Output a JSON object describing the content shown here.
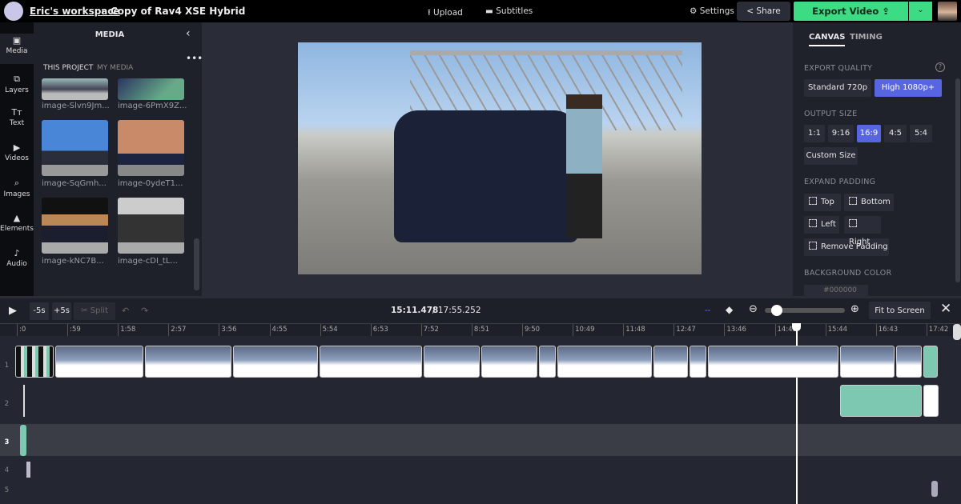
{
  "header": {
    "workspace": "Eric's workspace",
    "separator": "›",
    "project": "Copy of Rav4 XSE Hybrid",
    "upload": "Upload",
    "subtitles": "Subtitles",
    "settings": "Settings",
    "share": "Share",
    "export": "Export Video"
  },
  "rail": [
    {
      "label": "Media",
      "icon": "media-icon"
    },
    {
      "label": "Layers",
      "icon": "layers-icon"
    },
    {
      "label": "Text",
      "icon": "text-icon"
    },
    {
      "label": "Videos",
      "icon": "videos-icon"
    },
    {
      "label": "Images",
      "icon": "images-icon"
    },
    {
      "label": "Elements",
      "icon": "elements-icon"
    },
    {
      "label": "Audio",
      "icon": "audio-icon"
    }
  ],
  "media": {
    "title": "MEDIA",
    "tabs": [
      "THIS PROJECT",
      "MY MEDIA"
    ],
    "items": [
      "image-Slvn9Jm...",
      "image-6PmX9Z...",
      "image-SqGmh...",
      "image-0ydeT1...",
      "image-kNC7B...",
      "image-cDI_tL..."
    ]
  },
  "right": {
    "tabs": [
      "CANVAS",
      "TIMING"
    ],
    "export_quality": "EXPORT QUALITY",
    "quality_options": [
      "Standard 720p",
      "High 1080p+"
    ],
    "quality_selected": "High 1080p+",
    "output_size": "OUTPUT SIZE",
    "sizes": [
      "1:1",
      "9:16",
      "16:9",
      "4:5",
      "5:4"
    ],
    "size_selected": "16:9",
    "custom_size": "Custom Size",
    "expand_padding": "EXPAND PADDING",
    "padding": [
      "Top",
      "Bottom",
      "Left",
      "Right"
    ],
    "remove_padding": "Remove Padding",
    "background_color": "BACKGROUND COLOR",
    "bg_value": "#000000",
    "accent": "#5865e0"
  },
  "timeline": {
    "minus5": "-5s",
    "plus5": "+5s",
    "split": "Split",
    "current": "15:11.478",
    "total": "/ 17:55.252",
    "fit": "Fit to Screen",
    "zoom_level": 0.08,
    "ticks": [
      ":0",
      ":59",
      "1:58",
      "2:57",
      "3:56",
      "4:55",
      "5:54",
      "6:53",
      "7:52",
      "8:51",
      "9:50",
      "10:49",
      "11:48",
      "12:47",
      "13:46",
      "14:45",
      "15:44",
      "16:43",
      "17:42"
    ],
    "tracks": [
      "1",
      "2",
      "3",
      "4",
      "5"
    ],
    "playhead_fraction": 0.846
  }
}
